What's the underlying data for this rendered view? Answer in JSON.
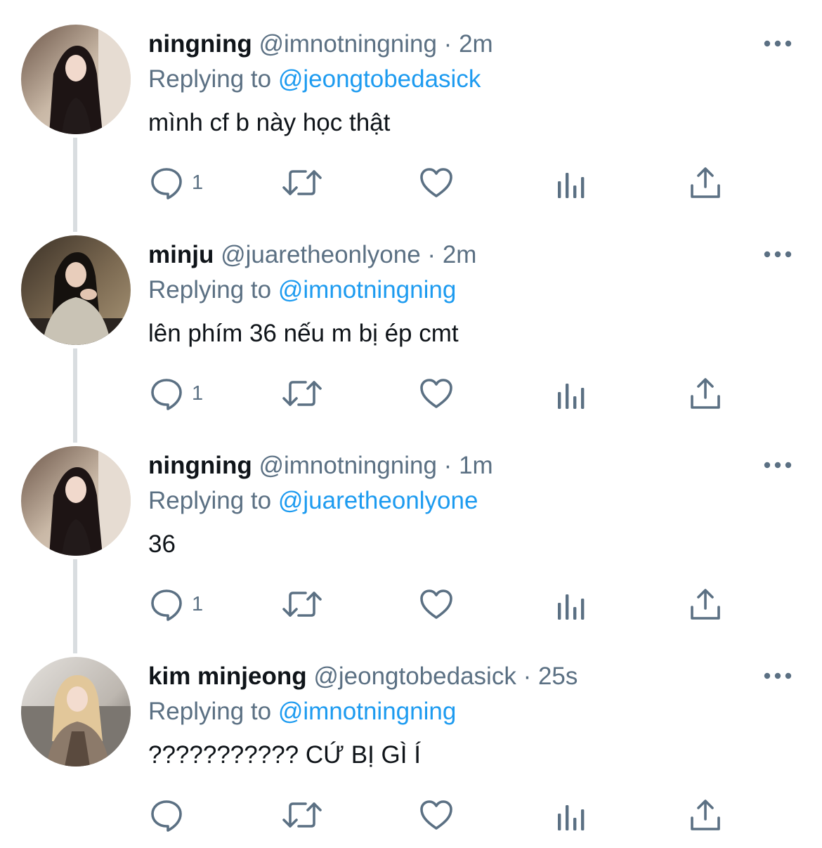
{
  "replying_prefix": "Replying to",
  "separator": "·",
  "tweets": [
    {
      "name": "ningning",
      "handle": "@imnotningning",
      "time": "2m",
      "reply_to": "@jeongtobedasick",
      "text": "mình cf b này học thật",
      "reply_count": "1"
    },
    {
      "name": "minju",
      "handle": "@juaretheonlyone",
      "time": "2m",
      "reply_to": "@imnotningning",
      "text": "lên phím 36 nếu m bị ép cmt",
      "reply_count": "1"
    },
    {
      "name": "ningning",
      "handle": "@imnotningning",
      "time": "1m",
      "reply_to": "@juaretheonlyone",
      "text": "36",
      "reply_count": "1"
    },
    {
      "name": "kim minjeong",
      "handle": "@jeongtobedasick",
      "time": "25s",
      "reply_to": "@imnotningning",
      "text": "??????????? CỨ BỊ GÌ Í",
      "reply_count": ""
    }
  ],
  "colors": {
    "text_primary": "#0f1419",
    "text_secondary": "#5b7083",
    "accent": "#1d9bf0",
    "thread_line": "#d9dde0"
  },
  "icons": [
    "reply-icon",
    "retweet-icon",
    "like-icon",
    "analytics-icon",
    "share-icon",
    "more-icon"
  ]
}
